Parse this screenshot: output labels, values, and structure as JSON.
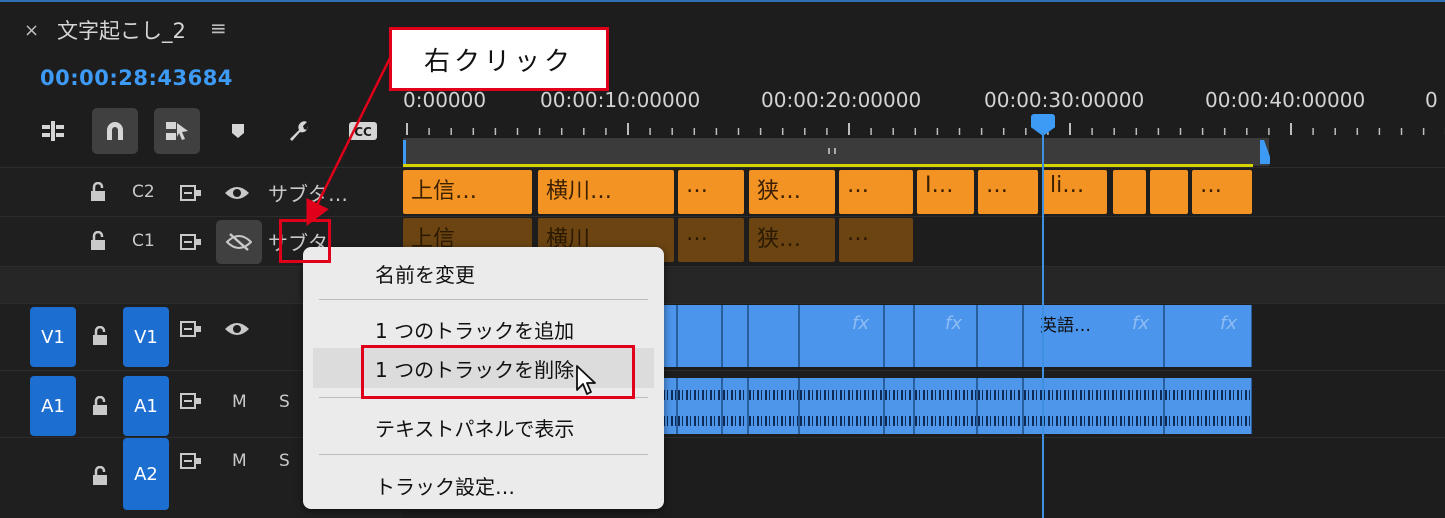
{
  "sequence": {
    "title": "文字起こし_2",
    "close_glyph": "×",
    "menu_glyph": "≡",
    "timecode": "00:00:28:43684"
  },
  "ruler": {
    "labels": [
      "0:00000",
      "00:00:10:00000",
      "00:00:20:00000",
      "00:00:30:00000",
      "00:00:40:00000",
      "0"
    ]
  },
  "tracks": {
    "c2": {
      "label": "C2",
      "name": "サブタ…"
    },
    "c1": {
      "label": "C1",
      "name": "サブタ…"
    },
    "v1": {
      "source": "V1",
      "target": "V1"
    },
    "a1": {
      "source": "A1",
      "target": "A1",
      "m": "M",
      "s": "S"
    },
    "a2": {
      "target": "A2",
      "m": "M",
      "s": "S"
    }
  },
  "caption_clips": {
    "c2": [
      "上信…",
      "横川…",
      "…",
      "狭…",
      "…",
      "I…",
      "…",
      "li…",
      "",
      "",
      "…"
    ],
    "c1": [
      "上信",
      "横川",
      "…",
      "狭…",
      "…"
    ]
  },
  "video_clips": {
    "named_clip": "英語…",
    "fx_label": "fx"
  },
  "context_menu": {
    "items": [
      "名前を変更",
      "1 つのトラックを追加",
      "1 つのトラックを削除",
      "テキストパネルで表示",
      "トラック設定…"
    ]
  },
  "annotation": {
    "callout": "右クリック",
    "accent": "#e0001a"
  },
  "colors": {
    "timecode": "#3d9af5",
    "caption_clip": "#f39323",
    "video_clip": "#4c95ec",
    "track_tag": "#1c6fd1"
  }
}
